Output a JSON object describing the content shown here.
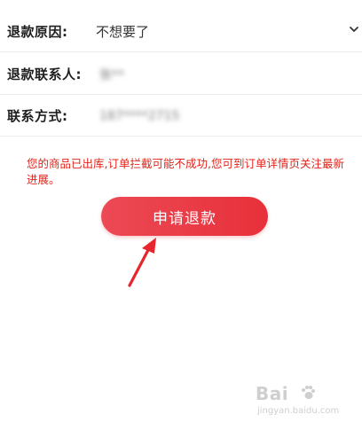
{
  "form": {
    "reason": {
      "label": "退款原因:",
      "value": "不想要了",
      "icon": "chevron-down-icon"
    },
    "contact": {
      "label": "退款联系人:",
      "value": "张**"
    },
    "phone": {
      "label": "联系方式:",
      "value": "187****2715"
    }
  },
  "notice": {
    "text": "您的商品已出库,订单拦截可能不成功,您可到订单详情页关注最新进展。"
  },
  "actions": {
    "submit_label": "申请退款"
  },
  "annotation": {
    "arrow_icon": "red-arrow-icon",
    "color": "#e8252e"
  },
  "watermark": {
    "logo_text": "Bai",
    "site_text": "jingyan.baidu.com"
  },
  "colors": {
    "accent": "#e7303a",
    "warning": "#e2231a"
  }
}
